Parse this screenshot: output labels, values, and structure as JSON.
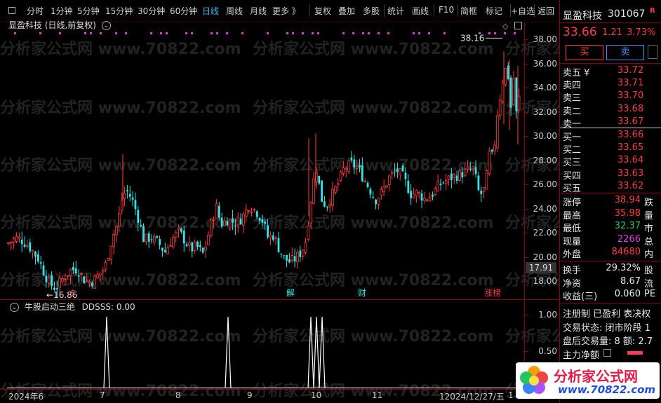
{
  "toolbar": {
    "periods": [
      "分时",
      "1分钟",
      "5分钟",
      "15分钟",
      "30分钟",
      "60分钟",
      "日线",
      "周线",
      "月线",
      "更多 》"
    ],
    "active_period": "日线",
    "tools": [
      "复权",
      "叠加",
      "多股",
      "统计",
      "画线",
      "F10",
      "简框",
      "标记",
      "+自选",
      "返回"
    ]
  },
  "main_chart": {
    "title": "显盈科技 (日线,前复权)",
    "y_ticks": [
      "38.00",
      "36.00",
      "34.00",
      "32.00",
      "30.00",
      "28.00",
      "26.00",
      "24.00",
      "22.00",
      "20.00",
      "18.00"
    ],
    "high_label": "38.16",
    "low_label": "←16.86",
    "current_price_label": "17.91",
    "event_markers": [
      "$",
      "解",
      "财",
      "涨榜"
    ]
  },
  "chart_data": {
    "type": "candlestick",
    "ylim": [
      16.5,
      38.7
    ],
    "y_ticks": [
      18,
      20,
      22,
      24,
      26,
      28,
      30,
      32,
      34,
      36,
      38
    ],
    "x_ticks": [
      "2024年6",
      "7",
      "8",
      "9",
      "10",
      "11",
      "12024/12/27/五",
      "1"
    ],
    "high": 38.16,
    "low": 16.86,
    "indicator": {
      "name": "牛股启动三绝",
      "series_name": "DDSSS",
      "current_value": "0.00",
      "y_ticks": [
        "1.00",
        "0.50"
      ],
      "spikes": [
        "07-01",
        "08-21",
        "10-08",
        "10-09",
        "10-10"
      ]
    }
  },
  "x_axis": {
    "labels": [
      "2024年6",
      "7",
      "8",
      "9",
      "10",
      "11",
      "12024/12/27/五",
      "1"
    ]
  },
  "quote": {
    "name": "显盈科技",
    "code": "301067",
    "price": "33.66",
    "change": "1.21",
    "change_pct": "3.73%",
    "buy_label": "买",
    "sell_label": "卖",
    "asks": [
      {
        "label": "卖五 ¥",
        "price": "33.72"
      },
      {
        "label": "卖四",
        "price": "33.71"
      },
      {
        "label": "卖三",
        "price": "33.70"
      },
      {
        "label": "卖二",
        "price": "33.68"
      },
      {
        "label": "卖一",
        "price": "33.67"
      }
    ],
    "bids": [
      {
        "label": "买一",
        "price": "33.66"
      },
      {
        "label": "买二",
        "price": "33.65"
      },
      {
        "label": "买三",
        "price": "33.64"
      },
      {
        "label": "买四",
        "price": "33.63"
      },
      {
        "label": "买五",
        "price": "33.62"
      }
    ],
    "stats": [
      {
        "label": "涨停",
        "value": "38.94",
        "extra": "跌"
      },
      {
        "label": "最高",
        "value": "35.98",
        "extra": "量"
      },
      {
        "label": "最低",
        "value": "32.37",
        "extra": "市"
      },
      {
        "label": "现量",
        "value": "2266",
        "extra": "总"
      },
      {
        "label": "外盘",
        "value": "84680",
        "extra": "内"
      }
    ],
    "stats2": [
      {
        "label": "换手",
        "value": "29.32%",
        "extra": "股"
      },
      {
        "label": "净资",
        "value": "8.67",
        "extra": "流"
      },
      {
        "label": "收益(三)",
        "value": "0.060",
        "extra": "PE"
      }
    ],
    "tags": "注册制 已盈利 表决权",
    "trade_status": "交易状态: 闭市阶段 1",
    "after_hours": "盘后交易量: 8  额: 2.7",
    "main_flow": "主力净额"
  },
  "watermark": {
    "text": "分析家公式网 www.70822.com",
    "logo_text": "分析家公式网",
    "logo_url": "www.70822.com"
  }
}
